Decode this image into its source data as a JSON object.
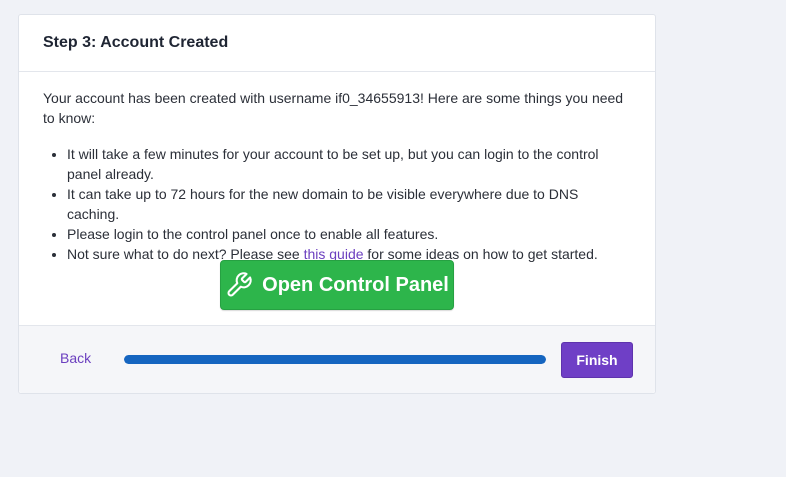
{
  "card": {
    "title": "Step 3: Account Created",
    "intro": "Your account has been created with username if0_34655913! Here are some things you need to know:",
    "bullets": {
      "b1": "It will take a few minutes for your account to be set up, but you can login to the control panel already.",
      "b2": "It can take up to 72 hours for the new domain to be visible everywhere due to DNS caching.",
      "b3": "Please login to the control panel once to enable all features.",
      "b4_before": "Not sure what to do next? Please see ",
      "b4_link": "this guide",
      "b4_after": " for some ideas on how to get started."
    },
    "control_panel_button": {
      "label": "Open Control Panel",
      "icon": "wrench-icon"
    }
  },
  "footer": {
    "back_label": "Back",
    "progress": 1.0,
    "finish_label": "Finish"
  },
  "colors": {
    "page_background": "#f0f2f7",
    "accent_purple": "#6f3fc6",
    "link_purple": "#6b3fbf",
    "success_green": "#2db54b",
    "progress_blue": "#1565c0"
  }
}
